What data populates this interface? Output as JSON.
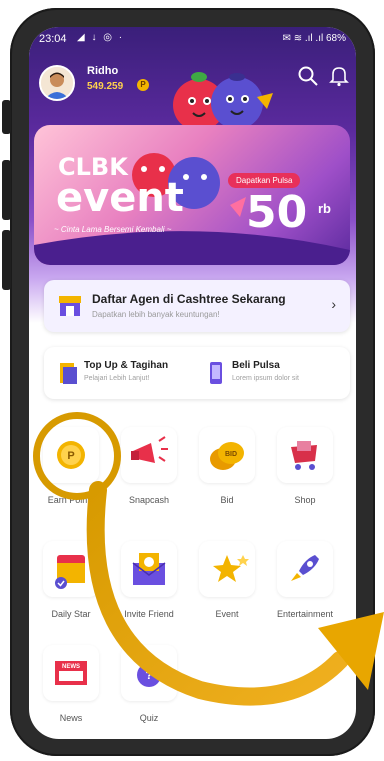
{
  "status": {
    "time": "23:04",
    "left_icons": "◢ ↓ ◎ ·",
    "right": "✉ ≋ .ıl .ıl 68%"
  },
  "user": {
    "name": "Ridho",
    "points": "549.259",
    "coin_symbol": "P"
  },
  "banner": {
    "brand": "CLBK",
    "title": "event",
    "tagline": "~ Cinta Lama Bersemi Kembali ~",
    "pill": "Dapatkan Pulsa",
    "amount": "50",
    "unit": "rb"
  },
  "agent": {
    "title": "Daftar Agen di Cashtree Sekarang",
    "subtitle": "Dapatkan lebih banyak keuntungan!"
  },
  "quick_actions": [
    {
      "title": "Top Up & Tagihan",
      "subtitle": "Pelajari Lebih Lanjut!"
    },
    {
      "title": "Beli Pulsa",
      "subtitle": "Lorem ipsum dolor sit"
    }
  ],
  "menu": [
    {
      "label": "Earn Points",
      "icon": "coin-icon"
    },
    {
      "label": "Snapcash",
      "icon": "megaphone-icon"
    },
    {
      "label": "Bid",
      "icon": "bid-coins-icon"
    },
    {
      "label": "Shop",
      "icon": "cart-icon"
    },
    {
      "label": "Daily Star",
      "icon": "calendar-icon"
    },
    {
      "label": "Invite Friend",
      "icon": "envelope-icon"
    },
    {
      "label": "Event",
      "icon": "stars-icon"
    },
    {
      "label": "Entertainment",
      "icon": "rocket-icon"
    },
    {
      "label": "News",
      "icon": "news-icon"
    },
    {
      "label": "Quiz",
      "icon": "quiz-icon"
    }
  ],
  "colors": {
    "accent_purple": "#5b2a9e",
    "highlight_gold": "#d79a00",
    "coin": "#f3b400"
  }
}
